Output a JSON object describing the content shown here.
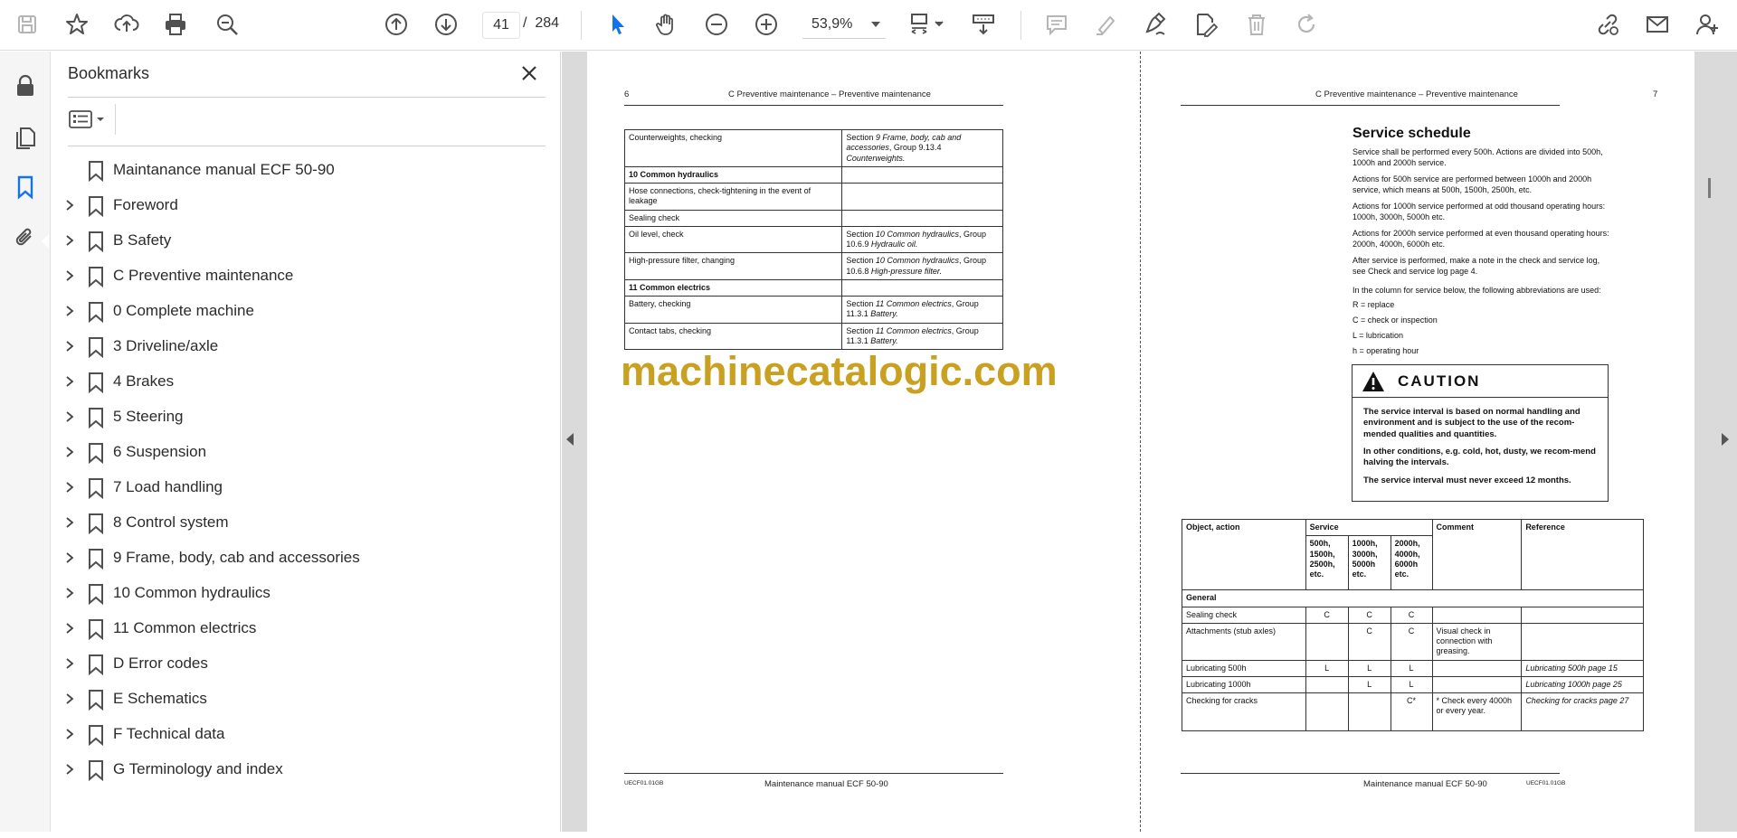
{
  "toolbar": {
    "page_current": "41",
    "page_separator": "/",
    "page_total": "284",
    "zoom": "53,9%",
    "icons": [
      "save-icon",
      "bookmark-star-icon",
      "upload-icon",
      "print-icon",
      "find-icon",
      "previous-page-icon",
      "next-page-icon",
      "zoom-out-icon",
      "zoom-in-icon",
      "select-cursor-icon",
      "hand-tool-icon",
      "fit-page-icon",
      "scroll-mode-icon",
      "comment-icon",
      "highlight-icon",
      "sign-icon",
      "edit-pdf-icon",
      "delete-icon",
      "rotate-icon",
      "share-link-icon",
      "email-icon",
      "account-icon"
    ]
  },
  "bookmarks": {
    "title": "Bookmarks",
    "items": [
      {
        "label": "Maintanance manual ECF 50-90",
        "expandable": false
      },
      {
        "label": "Foreword",
        "expandable": true
      },
      {
        "label": "B Safety",
        "expandable": true
      },
      {
        "label": "C Preventive maintenance",
        "expandable": true
      },
      {
        "label": "0 Complete machine",
        "expandable": true
      },
      {
        "label": "3 Driveline/axle",
        "expandable": true
      },
      {
        "label": "4 Brakes",
        "expandable": true
      },
      {
        "label": "5 Steering",
        "expandable": true
      },
      {
        "label": "6 Suspension",
        "expandable": true
      },
      {
        "label": "7 Load handling",
        "expandable": true
      },
      {
        "label": "8 Control system",
        "expandable": true
      },
      {
        "label": "9 Frame, body, cab and accessories",
        "expandable": true
      },
      {
        "label": "10 Common hydraulics",
        "expandable": true
      },
      {
        "label": "11 Common electrics",
        "expandable": true
      },
      {
        "label": "D Error codes",
        "expandable": true
      },
      {
        "label": "E Schematics",
        "expandable": true
      },
      {
        "label": "F Technical data",
        "expandable": true
      },
      {
        "label": "G Terminology and index",
        "expandable": true
      }
    ]
  },
  "left_page": {
    "page_number": "6",
    "header": "C Preventive maintenance – Preventive maintenance",
    "rows": [
      {
        "action": "Counterweights, checking",
        "ref_plain": "Section ",
        "ref_italic": "9 Frame, body, cab and accessories",
        "ref_tail": ", Group 9.13.4 ",
        "ref_italic2": "Counterweights.",
        "heading": false
      },
      {
        "action": "10 Common hydraulics",
        "heading": true
      },
      {
        "action": "Hose connections, check-tightening in the event of leakage",
        "heading": false
      },
      {
        "action": "Sealing check",
        "heading": false
      },
      {
        "action": "Oil level, check",
        "ref_plain": "Section ",
        "ref_italic": "10 Common hydraulics",
        "ref_tail": ", Group 10.6.9 ",
        "ref_italic2": "Hydraulic oil.",
        "heading": false
      },
      {
        "action": "High-pressure filter, changing",
        "ref_plain": "Section ",
        "ref_italic": "10 Common hydraulics",
        "ref_tail": ", Group 10.6.8 ",
        "ref_italic2": "High-pressure filter.",
        "heading": false
      },
      {
        "action": "11 Common electrics",
        "heading": true
      },
      {
        "action": "Battery, checking",
        "ref_plain": "Section ",
        "ref_italic": "11 Common electrics",
        "ref_tail": ", Group 11.3.1 ",
        "ref_italic2": "Battery.",
        "heading": false
      },
      {
        "action": "Contact tabs, checking",
        "ref_plain": "Section ",
        "ref_italic": "11 Common electrics",
        "ref_tail": ", Group 11.3.1 ",
        "ref_italic2": "Battery.",
        "heading": false
      }
    ],
    "footer_code": "UECF01.01GB",
    "footer_title": "Maintenance manual ECF 50-90"
  },
  "watermark": "machinecatalogic.com",
  "right_page": {
    "page_number": "7",
    "header": "C Preventive maintenance – Preventive maintenance",
    "title": "Service schedule",
    "paragraphs": [
      "Service shall be performed every 500h. Actions are divided into 500h, 1000h and 2000h service.",
      "Actions for 500h service are performed between 1000h and 2000h service, which means at 500h, 1500h, 2500h, etc.",
      "Actions for 1000h service performed at odd thousand operating hours: 1000h, 3000h, 5000h etc.",
      "Actions for 2000h service performed at even thousand operating hours: 2000h, 4000h, 6000h etc.",
      "After service is performed, make a note in the check and service log, see Check and service log page 4.",
      "In the column for service below, the following abbreviations are used:",
      "R = replace",
      "C = check or inspection",
      "L = lubrication",
      "h = operating hour"
    ],
    "caution": {
      "word": "CAUTION",
      "p1": "The service interval is based on normal handling and environment and is subject to the use of the recom-mended qualities and quantities.",
      "p2": "In other conditions, e.g. cold, hot, dusty, we recom-mend halving the intervals.",
      "p3": "The service interval must never exceed 12 months."
    },
    "table": {
      "h_object": "Object, action",
      "h_service": "Service",
      "h_comment": "Comment",
      "h_reference": "Reference",
      "sub1": "500h, 1500h, 2500h, etc.",
      "sub2": "1000h, 3000h, 5000h etc.",
      "sub3": "2000h, 4000h, 6000h etc.",
      "group": "General",
      "rows": [
        {
          "action": "Sealing check",
          "s1": "C",
          "s2": "C",
          "s3": "C",
          "comment": "",
          "reference": ""
        },
        {
          "action": "Attachments (stub axles)",
          "s1": "",
          "s2": "C",
          "s3": "C",
          "comment": "Visual check in connection with greasing.",
          "reference": ""
        },
        {
          "action": "Lubricating 500h",
          "s1": "L",
          "s2": "L",
          "s3": "L",
          "comment": "",
          "reference": "Lubricating 500h page 15"
        },
        {
          "action": "Lubricating 1000h",
          "s1": "",
          "s2": "L",
          "s3": "L",
          "comment": "",
          "reference": "Lubricating 1000h page 25"
        },
        {
          "action": "Checking for cracks",
          "s1": "",
          "s2": "",
          "s3": "C*",
          "comment": "* Check every 4000h or every year.",
          "reference": "Checking for cracks page 27"
        }
      ]
    },
    "footer_title": "Maintenance manual ECF 50-90",
    "footer_code": "UECF01.01GB"
  }
}
